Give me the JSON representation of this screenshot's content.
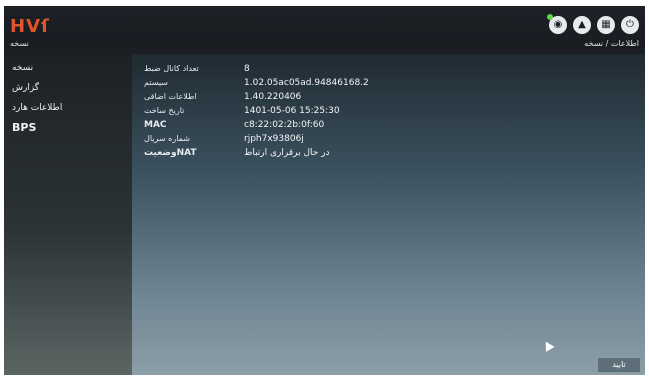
{
  "header": {
    "logo": "HVſ",
    "section": "نسخه",
    "breadcrumb": "اطلاعات / نسخه"
  },
  "top_icons": [
    {
      "name": "eye-icon",
      "glyph": "◉"
    },
    {
      "name": "user-icon",
      "glyph": "▲"
    },
    {
      "name": "grid-icon",
      "glyph": "▦"
    },
    {
      "name": "power-icon",
      "glyph": "⏻"
    }
  ],
  "sidebar": {
    "items": [
      {
        "label": "نسخه"
      },
      {
        "label": "گزارش"
      },
      {
        "label": "اطلاعات هارد"
      },
      {
        "label": "BPS"
      }
    ]
  },
  "info": {
    "rows": [
      {
        "label": "تعداد کانال ضبط",
        "value": "8"
      },
      {
        "label": "سیستم",
        "value": "1.02.05ac05ad.94846168.2"
      },
      {
        "label": "اطلاعات اضافی",
        "value": "1.40.220406"
      },
      {
        "label": "تاریخ ساخت",
        "value": "1401-05-06 15:25:30"
      },
      {
        "label": "MAC",
        "value": "c8:22:02:2b:0f:60"
      },
      {
        "label": "شماره سریال",
        "value": "rjph7x93806j"
      },
      {
        "label": "وضعیتNAT",
        "value": "در حال برقراری ارتباط"
      }
    ]
  },
  "footer": {
    "ok_label": "تایید"
  }
}
